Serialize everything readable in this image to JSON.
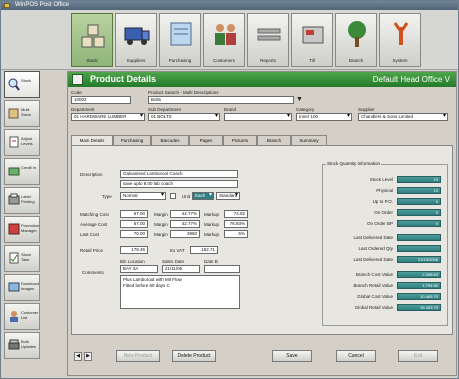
{
  "window": {
    "title": "WinPOS Post Office"
  },
  "toolbar": [
    {
      "label": "Stock",
      "icon": "stock-icon"
    },
    {
      "label": "Suppliers",
      "icon": "suppliers-icon"
    },
    {
      "label": "Purchasing",
      "icon": "purchasing-icon"
    },
    {
      "label": "Customers",
      "icon": "customers-icon"
    },
    {
      "label": "Reports",
      "icon": "reports-icon"
    },
    {
      "label": "Till",
      "icon": "till-icon"
    },
    {
      "label": "Branch",
      "icon": "branch-icon"
    },
    {
      "label": "System",
      "icon": "system-icon"
    }
  ],
  "sidebar": [
    {
      "label": "Stock",
      "icon": "magnifier-icon"
    },
    {
      "label": "Multi Stock",
      "icon": "multi-stock-icon"
    },
    {
      "label": "Adjust Levels",
      "icon": "adjust-icon"
    },
    {
      "label": "Credit In",
      "icon": "credit-icon"
    },
    {
      "label": "Label Printing",
      "icon": "label-icon"
    },
    {
      "label": "Promotion Manager",
      "icon": "promotion-icon"
    },
    {
      "label": "Stock Take",
      "icon": "stocktake-icon"
    },
    {
      "label": "Download Images",
      "icon": "download-icon"
    },
    {
      "label": "Customer List",
      "icon": "customer-list-icon"
    },
    {
      "label": "Bulk Updates",
      "icon": "bulk-icon"
    }
  ],
  "header": {
    "title": "Product Details",
    "office": "Default Head Office V"
  },
  "product": {
    "code_label": "Code",
    "code": "10002",
    "search_label": "Product Search - Multi Descriptions",
    "search": "Bolts",
    "department_label": "Department",
    "department": "01 HARDWARE LUMBER",
    "sub_department_label": "Sub Department",
    "sub_department": "01 BOLTS",
    "brand_label": "Brand",
    "brand": "",
    "category_label": "Category",
    "category": "Inner 100",
    "supplier_label": "Supplier",
    "supplier": "Chandlers & Sons Limited"
  },
  "tabs": [
    "Main Details",
    "Purchasing",
    "Barcodes",
    "Pages",
    "Pictures",
    "Branch",
    "Summary"
  ],
  "main": {
    "description_label": "Description",
    "description": "Galvanised Lamborout Coach",
    "description2": "save upto 8.00 lab coach",
    "type_label": "Type",
    "type": "Normal",
    "unit_label": "Unit",
    "unit": "Each",
    "unit_type": "Standard",
    "matching_cost_label": "Matching Cost",
    "matching_cost": "67.00",
    "average_cost_label": "Average Cost",
    "average_cost": "67.00",
    "last_cost_label": "Last Cost",
    "last_cost": "70.00",
    "margin_label": "Margin",
    "margin1": "42.77%",
    "margin2": "42.77%",
    "margin3": "3960",
    "markup_label": "Markup",
    "markup1": "74.92",
    "markup2": "76.93%",
    "markup3": "5%",
    "retail_price_label": "Retail Price",
    "retail_price": "179.45",
    "ex_vat_label": "Ex VAT",
    "ex_vat": "152.71",
    "bin_location_label": "Bin Location",
    "bin_location": "BAY 3A",
    "sales_date_label": "Sales Date",
    "sales_date": "21/11/06",
    "date_label": "Date B",
    "date": "",
    "comments_label": "Comments",
    "comments": [
      "Plus Lamborout with Mit Flow",
      "Fitted before 60 days C"
    ]
  },
  "stock_info": {
    "title": "Stock Quantity Information",
    "rows": [
      {
        "label": "Stock Level",
        "value": "10"
      },
      {
        "label": "Physical",
        "value": "10"
      },
      {
        "label": "Up to P.O.",
        "value": "0"
      },
      {
        "label": "On Order",
        "value": "0"
      },
      {
        "label": "On Order BP",
        "value": "0"
      },
      {
        "label": "Last Delivered Date",
        "value": ""
      },
      {
        "label": "Last Ordered Qty",
        "value": ""
      },
      {
        "label": "Last Delivered Date",
        "value": "21/10/2006"
      },
      {
        "label": "Branch Cost Value",
        "value": "2,398.63"
      },
      {
        "label": "Branch Retail Value",
        "value": "1,794.50"
      },
      {
        "label": "Global Cost Value",
        "value": "10,465.70"
      },
      {
        "label": "Global Retail Value",
        "value": "15,453.75"
      }
    ]
  },
  "buttons": {
    "new_product": "New Product",
    "delete_product": "Delete Product",
    "save": "Save",
    "cancel": "Cancel",
    "exit": "Exit"
  },
  "nav": {
    "prev": "◀",
    "next": "▶"
  },
  "colors": {
    "header_green": "#237a2a",
    "stock_teal": "#2f7f80"
  }
}
